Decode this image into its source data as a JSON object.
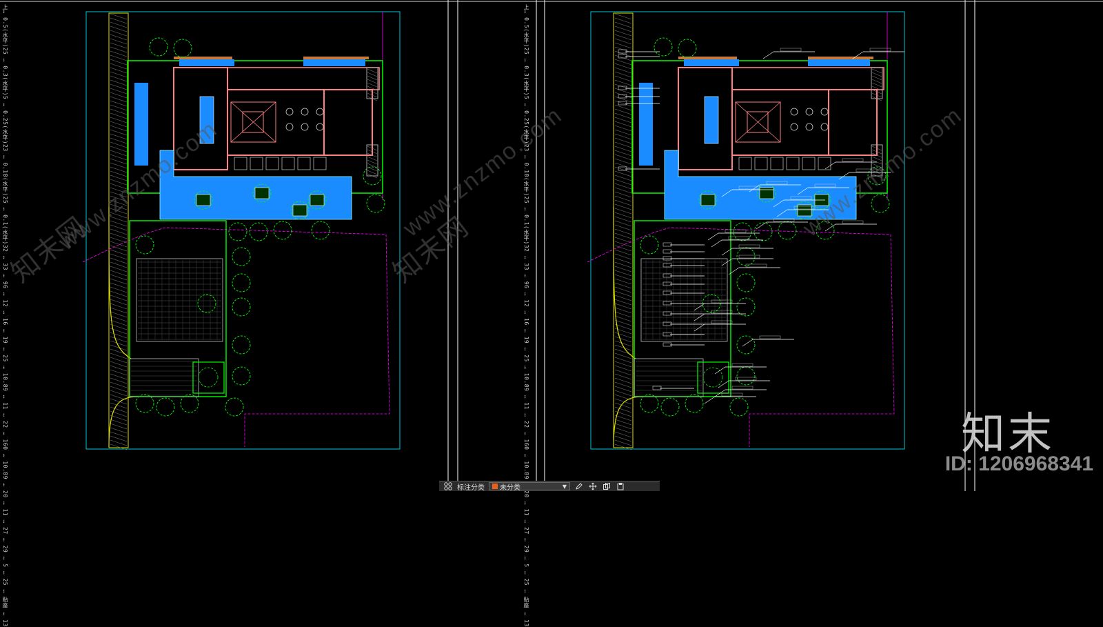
{
  "sheet_side_text": {
    "left": "上… 0.5(水平)25 … 0.3(水平)5 … 0.25(水平)23 … 0.18(水平)25 … 0.1(水平)32 … 33 … 96 … 12 … 16 … 19 … 25 … 10.89 … 11 … 22 … 160 … 10.89 … 20 … 11 … 27 … 29 … 5 … 25 … 贴座 … 13",
    "right": "上… 0.5(水平)25 … 0.3(水平)5 … 0.25(水平)23 … 0.18(水平)25 … 0.1(水平)32 … 33 … 96 … 12 … 16 … 19 … 25 … 10.89 … 11 … 22 … 160 … 10.89 … 20 … 11 … 27 … 29 … 5 … 25 … 贴座 … 13"
  },
  "watermark": {
    "site": "www.znzmo.com",
    "brand": "知末网",
    "logo": "知末",
    "id_text": "ID: 1206968341"
  },
  "toolbar": {
    "label": "标注分类",
    "selected": "未分类",
    "icons": [
      "annotate-cluster-icon",
      "edit-pen-icon",
      "move-icon",
      "copy-icon",
      "paste-icon"
    ]
  },
  "colors": {
    "background": "#000000",
    "frame": "#00c8d8",
    "wall": "#ff8080",
    "water": "#1a8cff",
    "plant": "#00ff00",
    "paving": "#c0c0c0",
    "boundary": "#e0e000",
    "leader": "#ffffff",
    "magenta": "#ff00ff"
  }
}
